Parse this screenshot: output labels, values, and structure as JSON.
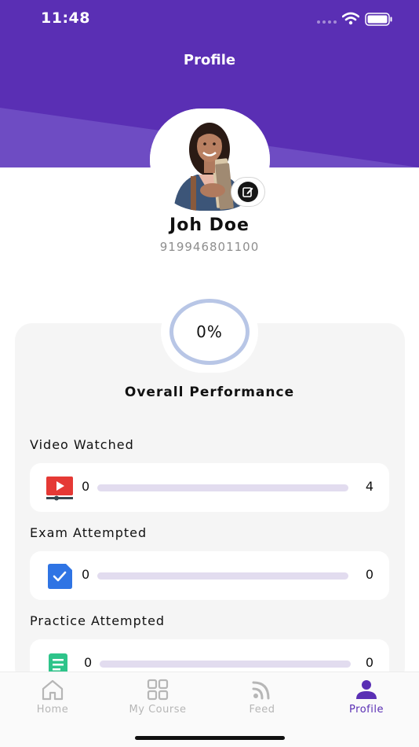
{
  "status_bar": {
    "time": "11:48",
    "icons": [
      "signal-dots-icon",
      "wifi-icon",
      "battery-icon"
    ]
  },
  "header": {
    "title": "Profile",
    "background_color": "#5a2fb4"
  },
  "profile": {
    "name": "Joh Doe",
    "phone": "919946801100",
    "avatar_icon": "student-photo",
    "edit_icon": "edit-icon"
  },
  "performance": {
    "percent_label": "0%",
    "percent_value": 0,
    "title": "Overall Performance",
    "stats": [
      {
        "label": "Video Watched",
        "current": "0",
        "total": "4",
        "icon": "video-icon"
      },
      {
        "label": "Exam Attempted",
        "current": "0",
        "total": "0",
        "icon": "exam-check-icon"
      },
      {
        "label": "Practice Attempted",
        "current": "0",
        "total": "0",
        "icon": "practice-sheet-icon"
      }
    ]
  },
  "bottom_nav": {
    "items": [
      {
        "label": "Home",
        "icon": "home-icon",
        "active": false
      },
      {
        "label": "My Course",
        "icon": "grid-icon",
        "active": false
      },
      {
        "label": "Feed",
        "icon": "rss-icon",
        "active": false
      },
      {
        "label": "Profile",
        "icon": "person-icon",
        "active": true
      }
    ],
    "active_color": "#5a2fb4",
    "inactive_color": "#b6b6b6"
  }
}
